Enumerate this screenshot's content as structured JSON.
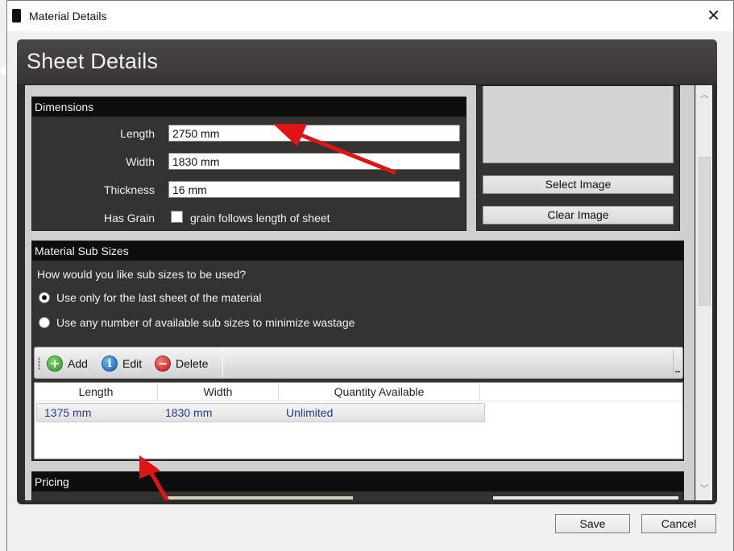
{
  "window": {
    "title": "Material Details",
    "close_glyph": "✕"
  },
  "panel": {
    "title": "Sheet Details"
  },
  "dimensions": {
    "header": "Dimensions",
    "length_label": "Length",
    "length_value": "2750 mm",
    "width_label": "Width",
    "width_value": "1830 mm",
    "thickness_label": "Thickness",
    "thickness_value": "16 mm",
    "grain_label": "Has Grain",
    "grain_checkbox_label": "grain follows length of sheet",
    "grain_checked": false
  },
  "image": {
    "select_label": "Select Image",
    "clear_label": "Clear Image"
  },
  "sub_sizes": {
    "header": "Material Sub Sizes",
    "question": "How would you like sub sizes to be used?",
    "options": [
      {
        "label": "Use only for the last sheet of the material",
        "checked": true
      },
      {
        "label": "Use any number of available sub sizes to minimize wastage",
        "checked": false
      }
    ],
    "toolbar": {
      "add_label": "Add",
      "edit_label": "Edit",
      "delete_label": "Delete"
    },
    "table": {
      "columns": [
        "Length",
        "Width",
        "Quantity Available"
      ],
      "rows": [
        [
          "1375 mm",
          "1830 mm",
          "Unlimited"
        ]
      ]
    }
  },
  "pricing": {
    "header": "Pricing"
  },
  "footer": {
    "save_label": "Save",
    "cancel_label": "Cancel"
  },
  "colors": {
    "panel_bg": "#2e2b2b",
    "section_header_bg": "#0d0d0d",
    "annotation_arrow": "#e01414",
    "table_text": "#1f3a8f",
    "add_icon": "#3aa335",
    "edit_icon": "#1b6fc2",
    "delete_icon": "#d42020"
  },
  "icons": {
    "app": "app-icon",
    "add": "plus-circle-icon",
    "edit": "info-circle-icon",
    "delete": "minus-circle-icon",
    "scroll_up": "chevron-up-icon",
    "scroll_down": "chevron-down-icon"
  }
}
